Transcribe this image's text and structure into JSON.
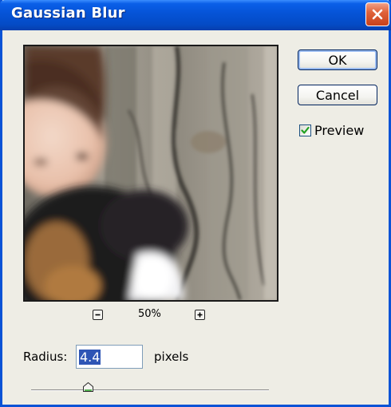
{
  "window": {
    "title": "Gaussian Blur",
    "close_icon": "close-icon"
  },
  "buttons": {
    "ok_label": "OK",
    "cancel_label": "Cancel"
  },
  "preview": {
    "label": "Preview",
    "checked": true,
    "image_description_icon": "preview-image"
  },
  "zoom": {
    "minus_icon": "zoom-out-icon",
    "plus_icon": "zoom-in-icon",
    "level": "50%"
  },
  "radius": {
    "label": "Radius:",
    "value": "4.4",
    "units": "pixels",
    "slider_fraction": 0.24
  },
  "colors": {
    "titlebar": "#0553d6",
    "dialog_bg": "#eeede5",
    "close_button": "#d8522c",
    "selection": "#2e55b5"
  }
}
